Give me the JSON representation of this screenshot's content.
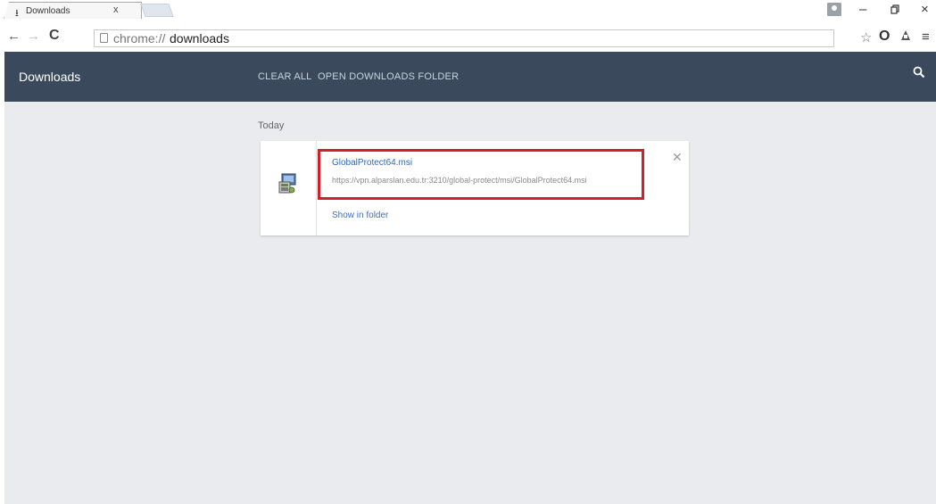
{
  "tab": {
    "title": "Downloads",
    "close": "x"
  },
  "window": {
    "minimize": "–",
    "maximize": "▫",
    "close": "×"
  },
  "toolbar": {
    "url_scheme": "chrome://",
    "url_host": "downloads"
  },
  "header": {
    "title": "Downloads",
    "clear_all": "CLEAR ALL",
    "open_folder": "OPEN DOWNLOADS FOLDER"
  },
  "content": {
    "section": "Today",
    "items": [
      {
        "file_name": "GlobalProtect64.msi",
        "url": "https://vpn.alparslan.edu.tr:3210/global-protect/msi/GlobalProtect64.msi",
        "show_in_folder": "Show in folder"
      }
    ]
  },
  "colors": {
    "header_bg": "#3a4a5c",
    "content_bg": "#e9ebee",
    "link": "#2f67b6",
    "highlight": "#d21f2b"
  }
}
